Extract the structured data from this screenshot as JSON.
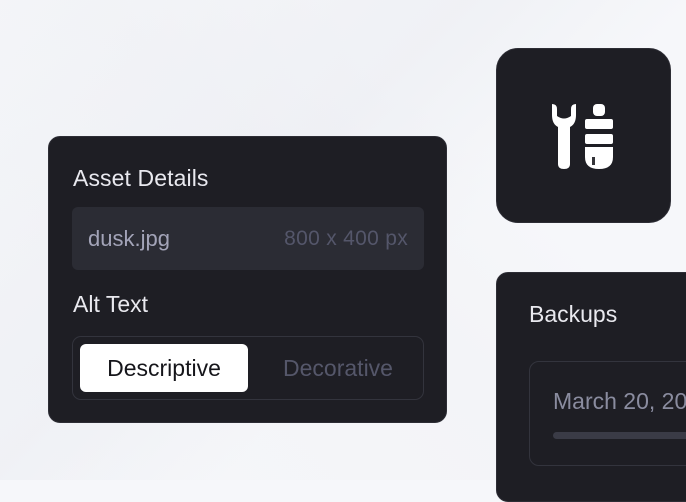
{
  "asset_details": {
    "title": "Asset Details",
    "file_name": "dusk.jpg",
    "dimensions": "800 x 400 px",
    "alt_text_label": "Alt Text",
    "alt_text_options": [
      "Descriptive",
      "Decorative"
    ],
    "selected_option": "Descriptive"
  },
  "tools_tile": {
    "icon": "tools-icon"
  },
  "backups": {
    "title": "Backups",
    "items": [
      {
        "date": "March 20, 20"
      }
    ]
  },
  "colors": {
    "background": "#f6f7fa",
    "card": "#1e1e24",
    "accent_text": "#e9e9ef"
  }
}
